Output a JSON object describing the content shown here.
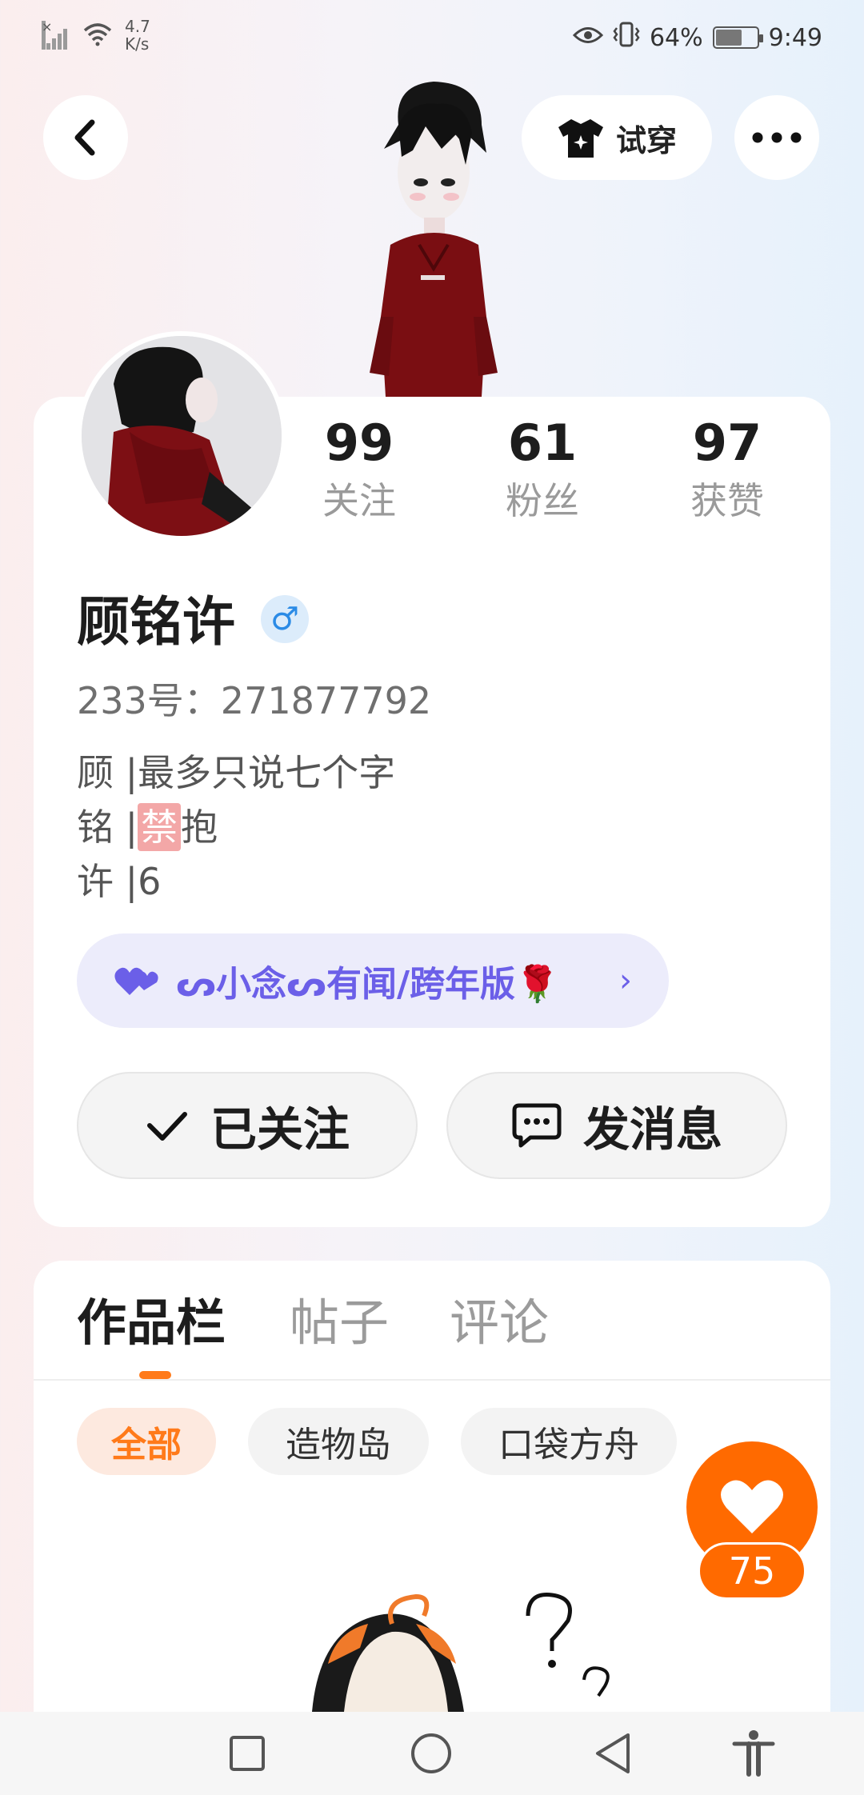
{
  "status_bar": {
    "net_speed_value": "4.7",
    "net_speed_unit": "K/s",
    "battery_percent": "64%",
    "battery_level": 0.64,
    "time": "9:49"
  },
  "header": {
    "try_on_label": "试穿"
  },
  "profile": {
    "stats": [
      {
        "value": "99",
        "label": "关注"
      },
      {
        "value": "61",
        "label": "粉丝"
      },
      {
        "value": "97",
        "label": "获赞"
      }
    ],
    "name": "顾铭许",
    "gender_symbol": "♂",
    "id_text": "233号：271877792",
    "bio": {
      "line1": "顾 |最多只说七个字",
      "line2_prefix": "铭 |",
      "line2_badge": "禁",
      "line2_suffix": "抱",
      "line3": "许 |6"
    },
    "club_label": "ᔕ小念ᔕ有闻/跨年版🌹",
    "followed_label": "已关注",
    "message_label": "发消息"
  },
  "works": {
    "tabs": [
      {
        "label": "作品栏",
        "active": true
      },
      {
        "label": "帖子",
        "active": false
      },
      {
        "label": "评论",
        "active": false
      }
    ],
    "filters": [
      {
        "label": "全部",
        "active": true
      },
      {
        "label": "造物岛",
        "active": false
      },
      {
        "label": "口袋方舟",
        "active": false
      }
    ],
    "like_count": "75"
  },
  "colors": {
    "accent": "#ff6a00",
    "club": "#6b5fe8",
    "gender": "#2b8be6"
  },
  "icons": [
    "back-arrow-icon",
    "tshirt-icon",
    "more-dots-icon",
    "check-icon",
    "message-bubble-icon",
    "heart-icon",
    "square-icon",
    "circle-icon",
    "triangle-back-icon",
    "accessibility-icon"
  ]
}
